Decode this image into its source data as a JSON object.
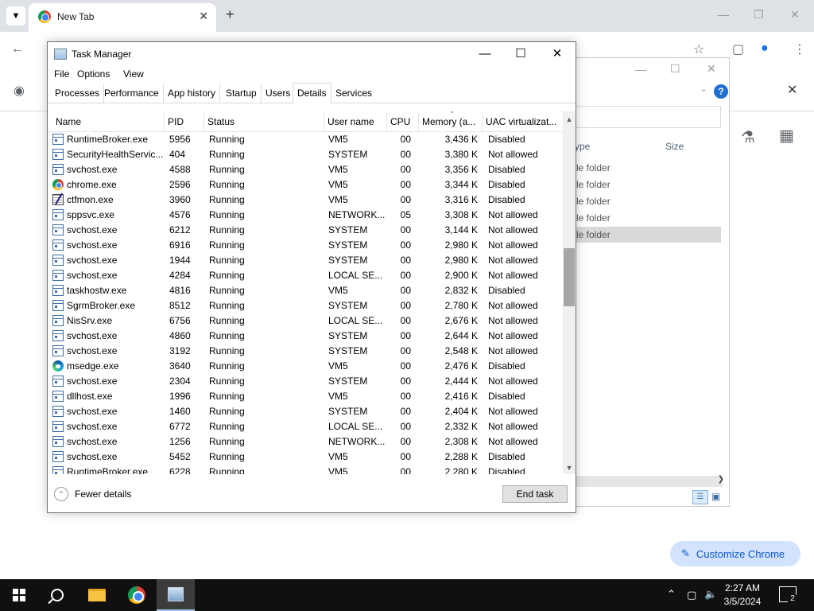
{
  "chrome": {
    "tab_title": "New Tab",
    "customize_label": "Customize Chrome"
  },
  "explorer": {
    "col_type": "ype",
    "col_size": "Size",
    "rows": [
      "le folder",
      "le folder",
      "le folder",
      "le folder",
      "le folder"
    ]
  },
  "taskmgr": {
    "title": "Task Manager",
    "menu": [
      "File",
      "Options",
      "View"
    ],
    "tabs": [
      "Processes",
      "Performance",
      "App history",
      "Startup",
      "Users",
      "Details",
      "Services"
    ],
    "active_tab": "Details",
    "columns": [
      "Name",
      "PID",
      "Status",
      "User name",
      "CPU",
      "Memory (a...",
      "UAC virtualizat..."
    ],
    "rows": [
      {
        "name": "RuntimeBroker.exe",
        "pid": "5956",
        "status": "Running",
        "user": "VM5",
        "cpu": "00",
        "mem": "3,436 K",
        "uac": "Disabled",
        "icon": "win"
      },
      {
        "name": "SecurityHealthServic...",
        "pid": "404",
        "status": "Running",
        "user": "SYSTEM",
        "cpu": "00",
        "mem": "3,380 K",
        "uac": "Not allowed",
        "icon": "win"
      },
      {
        "name": "svchost.exe",
        "pid": "4588",
        "status": "Running",
        "user": "VM5",
        "cpu": "00",
        "mem": "3,356 K",
        "uac": "Disabled",
        "icon": "win"
      },
      {
        "name": "chrome.exe",
        "pid": "2596",
        "status": "Running",
        "user": "VM5",
        "cpu": "00",
        "mem": "3,344 K",
        "uac": "Disabled",
        "icon": "chrome"
      },
      {
        "name": "ctfmon.exe",
        "pid": "3960",
        "status": "Running",
        "user": "VM5",
        "cpu": "00",
        "mem": "3,316 K",
        "uac": "Disabled",
        "icon": "ctf"
      },
      {
        "name": "sppsvc.exe",
        "pid": "4576",
        "status": "Running",
        "user": "NETWORK...",
        "cpu": "05",
        "mem": "3,308 K",
        "uac": "Not allowed",
        "icon": "win"
      },
      {
        "name": "svchost.exe",
        "pid": "6212",
        "status": "Running",
        "user": "SYSTEM",
        "cpu": "00",
        "mem": "3,144 K",
        "uac": "Not allowed",
        "icon": "win"
      },
      {
        "name": "svchost.exe",
        "pid": "6916",
        "status": "Running",
        "user": "SYSTEM",
        "cpu": "00",
        "mem": "2,980 K",
        "uac": "Not allowed",
        "icon": "win"
      },
      {
        "name": "svchost.exe",
        "pid": "1944",
        "status": "Running",
        "user": "SYSTEM",
        "cpu": "00",
        "mem": "2,980 K",
        "uac": "Not allowed",
        "icon": "win"
      },
      {
        "name": "svchost.exe",
        "pid": "4284",
        "status": "Running",
        "user": "LOCAL SE...",
        "cpu": "00",
        "mem": "2,900 K",
        "uac": "Not allowed",
        "icon": "win"
      },
      {
        "name": "taskhostw.exe",
        "pid": "4816",
        "status": "Running",
        "user": "VM5",
        "cpu": "00",
        "mem": "2,832 K",
        "uac": "Disabled",
        "icon": "win"
      },
      {
        "name": "SgrmBroker.exe",
        "pid": "8512",
        "status": "Running",
        "user": "SYSTEM",
        "cpu": "00",
        "mem": "2,780 K",
        "uac": "Not allowed",
        "icon": "win"
      },
      {
        "name": "NisSrv.exe",
        "pid": "6756",
        "status": "Running",
        "user": "LOCAL SE...",
        "cpu": "00",
        "mem": "2,676 K",
        "uac": "Not allowed",
        "icon": "win"
      },
      {
        "name": "svchost.exe",
        "pid": "4860",
        "status": "Running",
        "user": "SYSTEM",
        "cpu": "00",
        "mem": "2,644 K",
        "uac": "Not allowed",
        "icon": "win"
      },
      {
        "name": "svchost.exe",
        "pid": "3192",
        "status": "Running",
        "user": "SYSTEM",
        "cpu": "00",
        "mem": "2,548 K",
        "uac": "Not allowed",
        "icon": "win"
      },
      {
        "name": "msedge.exe",
        "pid": "3640",
        "status": "Running",
        "user": "VM5",
        "cpu": "00",
        "mem": "2,476 K",
        "uac": "Disabled",
        "icon": "edge"
      },
      {
        "name": "svchost.exe",
        "pid": "2304",
        "status": "Running",
        "user": "SYSTEM",
        "cpu": "00",
        "mem": "2,444 K",
        "uac": "Not allowed",
        "icon": "win"
      },
      {
        "name": "dllhost.exe",
        "pid": "1996",
        "status": "Running",
        "user": "VM5",
        "cpu": "00",
        "mem": "2,416 K",
        "uac": "Disabled",
        "icon": "win"
      },
      {
        "name": "svchost.exe",
        "pid": "1460",
        "status": "Running",
        "user": "SYSTEM",
        "cpu": "00",
        "mem": "2,404 K",
        "uac": "Not allowed",
        "icon": "win"
      },
      {
        "name": "svchost.exe",
        "pid": "6772",
        "status": "Running",
        "user": "LOCAL SE...",
        "cpu": "00",
        "mem": "2,332 K",
        "uac": "Not allowed",
        "icon": "win"
      },
      {
        "name": "svchost.exe",
        "pid": "1256",
        "status": "Running",
        "user": "NETWORK...",
        "cpu": "00",
        "mem": "2,308 K",
        "uac": "Not allowed",
        "icon": "win"
      },
      {
        "name": "svchost.exe",
        "pid": "5452",
        "status": "Running",
        "user": "VM5",
        "cpu": "00",
        "mem": "2,288 K",
        "uac": "Disabled",
        "icon": "win"
      },
      {
        "name": "RuntimeBroker.exe",
        "pid": "6228",
        "status": "Running",
        "user": "VM5",
        "cpu": "00",
        "mem": "2,280 K",
        "uac": "Disabled",
        "icon": "win"
      }
    ],
    "fewer_details": "Fewer details",
    "end_task": "End task"
  },
  "taskbar": {
    "time": "2:27 AM",
    "date": "3/5/2024",
    "notification_count": "2"
  }
}
